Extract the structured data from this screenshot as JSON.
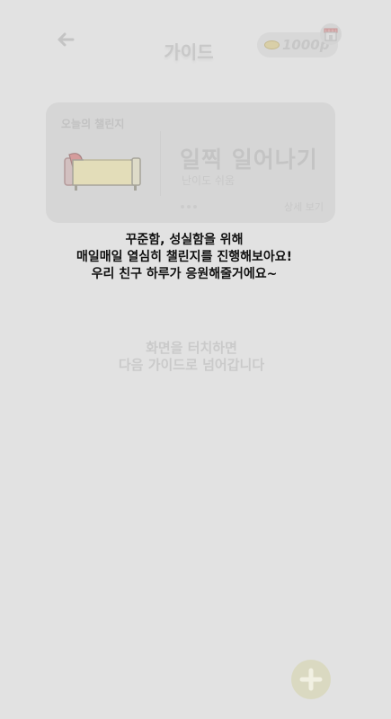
{
  "header": {
    "title": "가이드",
    "points": "1000p",
    "back_icon": "arrow-left-icon",
    "store_icon": "store-icon"
  },
  "challenge_card": {
    "header": "오늘의 챌린지",
    "title": "일찍 일어나기",
    "difficulty": "난이도 쉬움",
    "detail_link": "상세 보기",
    "image_icon": "bed-icon"
  },
  "guide": {
    "line1": "꾸준함, 성실함을 위해",
    "line2": "매일매일 열심히 챌린지를 진행해보아요!",
    "line3": "우리 친구 하루가 응원해줄거에요~"
  },
  "touch_hint": {
    "line1": "화면을 터치하면",
    "line2": "다음 가이드로 넘어갑니다"
  },
  "fab": {
    "icon": "plus-icon",
    "color": "#dad9c1"
  },
  "colors": {
    "background": "#e2e2e2",
    "card": "#d6d6d6",
    "guide_text": "#111111"
  }
}
